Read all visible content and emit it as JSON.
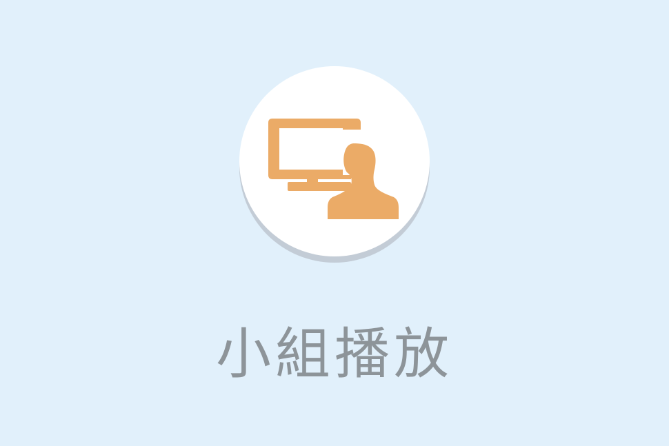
{
  "app": {
    "icon": "monitor-person-icon",
    "title": "小組播放"
  },
  "colors": {
    "background": "#e1f0fb",
    "circle": "#ffffff",
    "circle_shadow": "#c3ccd6",
    "icon": "#ebab67",
    "title": "#8d9499"
  }
}
